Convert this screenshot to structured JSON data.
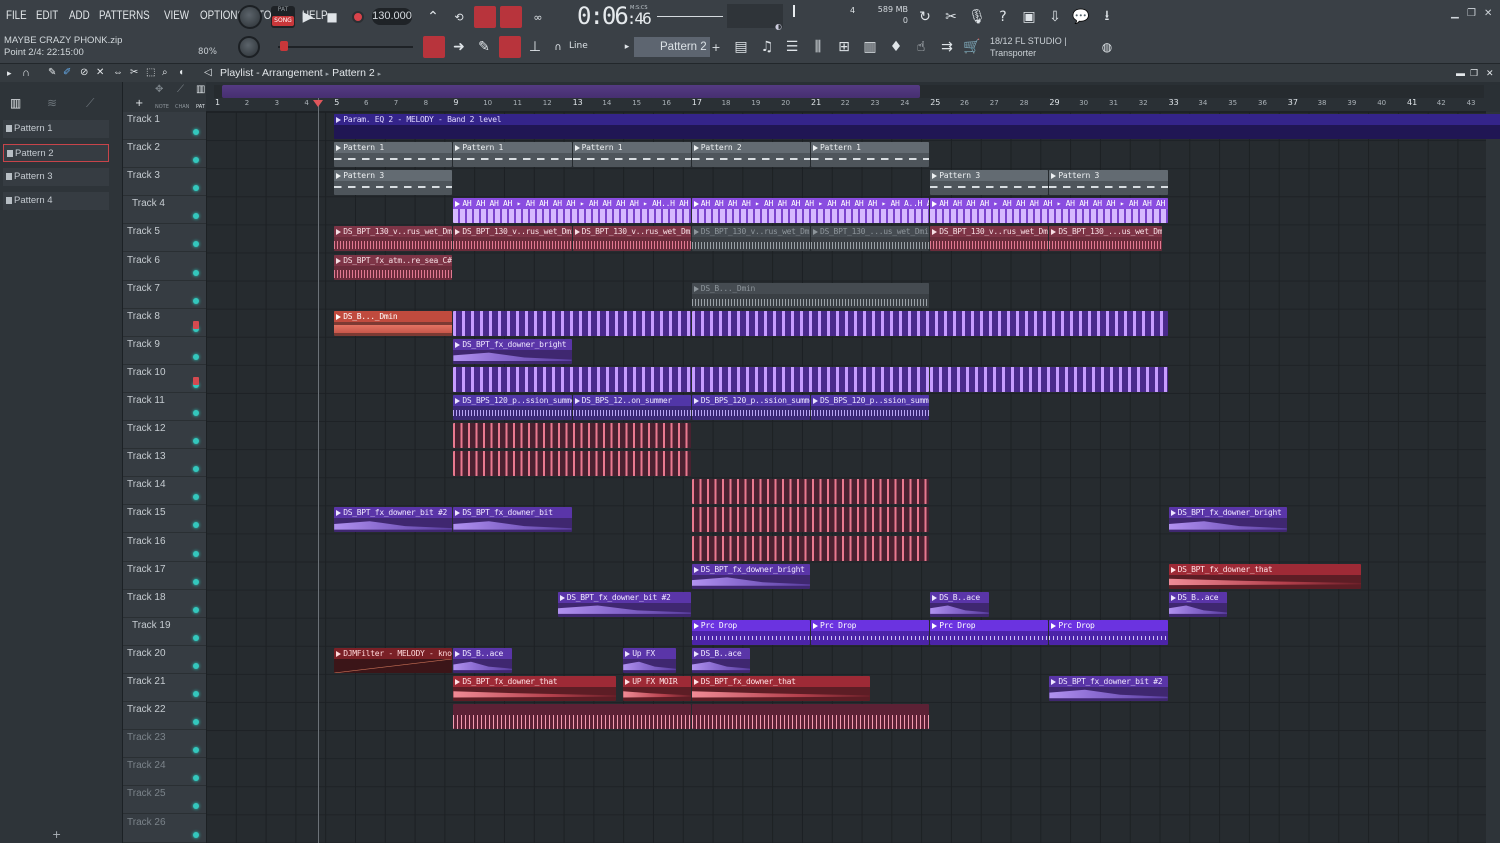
{
  "menu": [
    "FILE",
    "EDIT",
    "ADD",
    "PATTERNS",
    "VIEW",
    "OPTIONS",
    "TOOLS",
    "HELP"
  ],
  "project": {
    "name": "MAYBE CRAZY PHONK.zip",
    "position": "Point 2/4: 22:15:00",
    "zoom": "80%"
  },
  "transport": {
    "pat_label": "PAT",
    "song_label": "SONG",
    "tempo": "130.000",
    "time_main": "0:06",
    "time_sub": ":46",
    "time_format": "M:S:CS",
    "cpu_mem": "589 MB",
    "cpu_poly": "0",
    "cpu_val": "4"
  },
  "hint": {
    "line1": "18/12  FL STUDIO |",
    "line2": "Transporter"
  },
  "snap": "Line",
  "current_pattern": "Pattern 2",
  "playlist": {
    "title": "Playlist - Arrangement",
    "pattern": "Pattern 2"
  },
  "picker": [
    "Pattern 1",
    "Pattern 2",
    "Pattern 3",
    "Pattern 4"
  ],
  "tracks": [
    "Track 1",
    "Track 2",
    "Track 3",
    "Track 4",
    "Track 5",
    "Track 6",
    "Track 7",
    "Track 8",
    "Track 9",
    "Track 10",
    "Track 11",
    "Track 12",
    "Track 13",
    "Track 14",
    "Track 15",
    "Track 16",
    "Track 17",
    "Track 18",
    "Track 19",
    "Track 20",
    "Track 21",
    "Track 22",
    "Track 23",
    "Track 24",
    "Track 25",
    "Track 26"
  ],
  "ruler": [
    "1",
    "2",
    "3",
    "4",
    "5",
    "6",
    "7",
    "8",
    "9",
    "10",
    "11",
    "12",
    "13",
    "14",
    "15",
    "16",
    "17",
    "18",
    "19",
    "20",
    "21",
    "22",
    "23",
    "24",
    "25",
    "26",
    "27",
    "28",
    "29",
    "30",
    "31",
    "32",
    "33",
    "34",
    "35",
    "36",
    "37",
    "38",
    "39",
    "40",
    "41",
    "42",
    "43"
  ],
  "clips": {
    "param": "Param. EQ 2 - MELODY - Band 2 level",
    "p1": "Pattern 1",
    "p2": "Pattern 2",
    "p3": "Pattern 3",
    "ah1": "AH AH AH AH",
    "ah_a": "AH AH AH AH  ▸ AH AH AH AH  ▸ AH AH AH AH  ▸ AH..H AH",
    "ah_b": "AH AH AH AH  ▸ AH AH AH AH  ▸ AH AH AH AH  ▸ AH A..H AH",
    "ah_c": "AH AH AH AH  ▸ AH AH AH AH  ▸ AH AH AH AH  ▸ AH AH AH AH",
    "bpt1": "DS_BPT_130_v..rus_wet_Dmin",
    "bpt2": "DS_BPT_130_...us_wet_Dmin",
    "atm": "DS_BPT_fx_atm..re_sea_C#min",
    "dmin": "DS_B..._Dmin",
    "downer_bright": "DS_BPT_fx_downer_bright",
    "bps120": "DS_BPS_120_p..ssion_summer",
    "bps12": "DS_BPS_12..on_summer",
    "downer_bit2": "DS_BPT_fx_downer_bit #2",
    "downer_bit": "DS_BPT_fx_downer_bit",
    "downer_that": "DS_BPT_fx_downer_that",
    "ace": "DS_B..ace",
    "prc": "Prc Drop",
    "djm": "DJMFilter - MELODY - knob",
    "upfx": "Up FX",
    "upfxmoir": "UP FX MOIR"
  },
  "colors": {
    "accent_red": "#c8373a",
    "track_led": "#34c7bd",
    "clip_violet": "#8a4de0",
    "clip_prc": "#6b33e0"
  }
}
